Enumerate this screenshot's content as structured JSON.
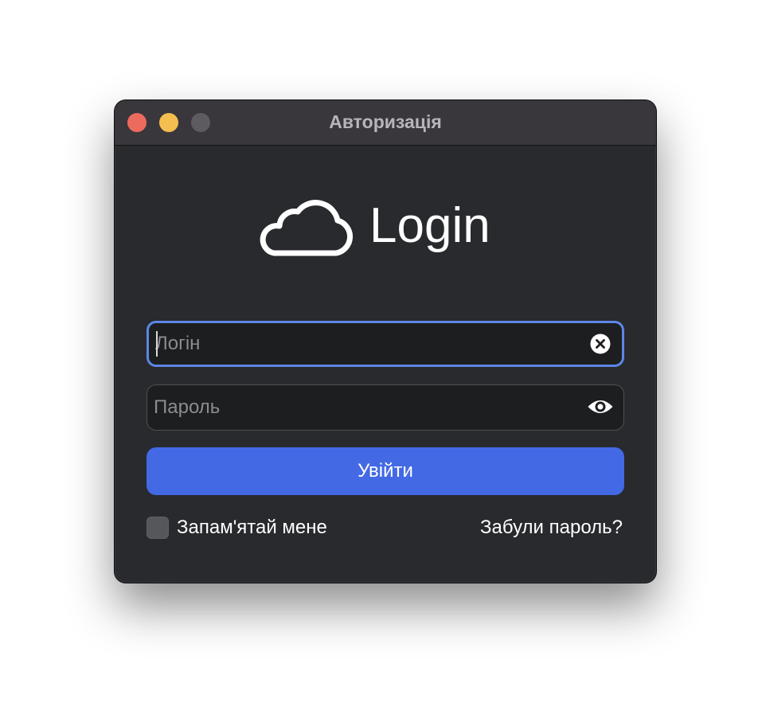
{
  "window": {
    "title": "Авторизація"
  },
  "logo": {
    "icon": "cloud-icon",
    "text": "Login"
  },
  "form": {
    "login": {
      "placeholder": "Логін",
      "value": "",
      "clear_icon": "clear-x-circle-icon"
    },
    "password": {
      "placeholder": "Пароль",
      "value": "",
      "reveal_icon": "eye-icon"
    },
    "submit_label": "Увійти",
    "remember_label": "Запам'ятай мене",
    "remember_checked": false,
    "forgot_label": "Забули пароль?"
  },
  "colors": {
    "window_bg": "#282a2e",
    "titlebar_bg": "#3a373c",
    "accent": "#4369e4",
    "focus_ring": "#5d86e6",
    "close": "#ec6a5e",
    "minimize": "#f4bf4f",
    "zoom_disabled": "#5d5b60"
  }
}
